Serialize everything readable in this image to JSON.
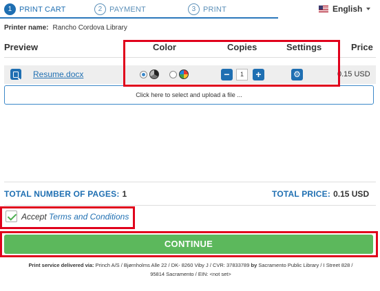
{
  "steps": [
    {
      "num": "1",
      "label": "PRINT CART"
    },
    {
      "num": "2",
      "label": "PAYMENT"
    },
    {
      "num": "3",
      "label": "PRINT"
    }
  ],
  "language": {
    "label": "English",
    "icon": "us-flag-icon"
  },
  "printer": {
    "label": "Printer name:",
    "value": "Rancho Cordova Library"
  },
  "table": {
    "headers": {
      "preview": "Preview",
      "color": "Color",
      "copies": "Copies",
      "settings": "Settings",
      "price": "Price"
    },
    "rows": [
      {
        "filename": "Resume.docx",
        "color_mode": "black-and-white",
        "copies": "1",
        "price": "0.15 USD"
      }
    ]
  },
  "upload": {
    "label": "Click here to select and upload a file ..."
  },
  "totals": {
    "pages_label": "TOTAL NUMBER OF PAGES:",
    "pages_value": "1",
    "price_label": "TOTAL PRICE:",
    "price_value": "0.15 USD"
  },
  "terms": {
    "accept": "Accept",
    "link": "Terms and Conditions",
    "checked": true
  },
  "continue_label": "CONTINUE",
  "footer": {
    "prefix": "Print service delivered via:",
    "text1": "Princh A/S  / Bjørnholms Alle 22  / DK- 8260 Viby J  / CVR:  37833789",
    "by": "by",
    "text2": "Sacramento Public Library  /  I Street 828  /",
    "line2": "95814 Sacramento  /  EIN:  <not set>"
  },
  "colors": {
    "accent": "#1f6fb2",
    "success": "#5cb85c",
    "highlight": "#e0001b"
  }
}
